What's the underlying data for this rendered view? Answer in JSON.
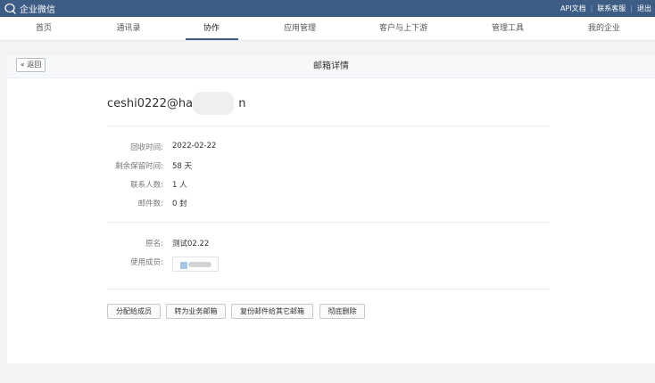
{
  "topbar": {
    "brand": "企业微信",
    "links": [
      "API文档",
      "联系客服",
      "退出"
    ]
  },
  "nav": {
    "items": [
      "首页",
      "通讯录",
      "协作",
      "应用管理",
      "客户与上下游",
      "管理工具",
      "我的企业"
    ],
    "active": "协作"
  },
  "panel": {
    "back_label": "« 返回",
    "title": "邮箱详情",
    "email_visible": "ceshi0222@hac",
    "email_tail": "n",
    "details": [
      {
        "label": "回收时间:",
        "value": "2022-02-22"
      },
      {
        "label": "剩余保留时间:",
        "value": "58 天"
      },
      {
        "label": "联系人数:",
        "value": "1 人"
      },
      {
        "label": "邮件数:",
        "value": "0 封"
      }
    ],
    "original_name_label": "原名:",
    "original_name_value": "测试02.22",
    "members_label": "使用成员:",
    "actions": [
      "分配给成员",
      "转为业务邮箱",
      "复份邮件给其它邮箱",
      "彻底删除"
    ]
  }
}
